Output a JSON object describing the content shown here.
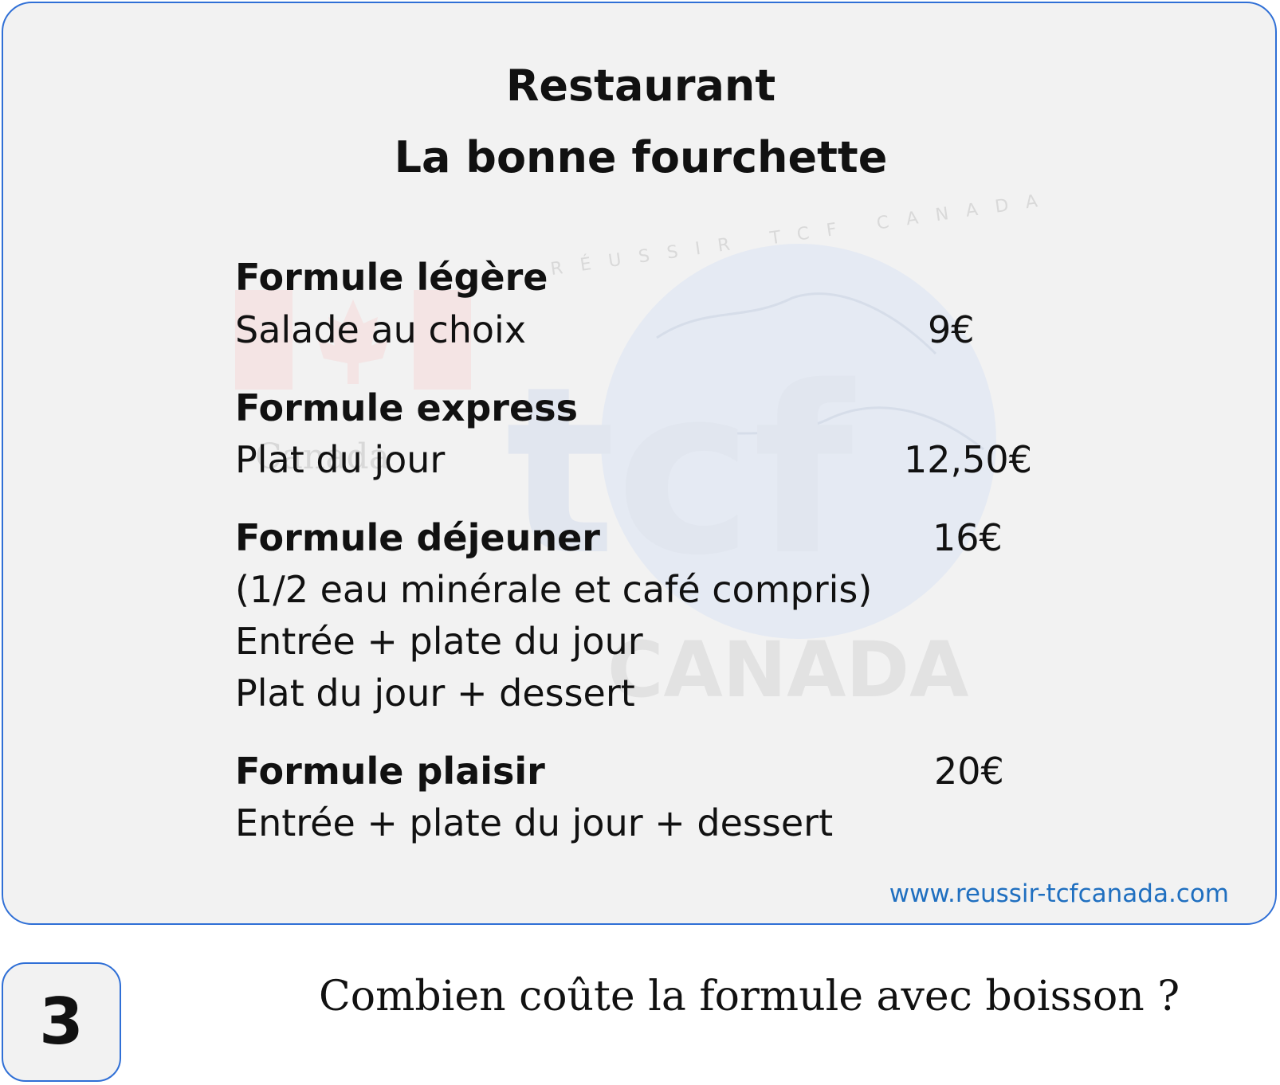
{
  "card": {
    "title_line1": "Restaurant",
    "title_line2": "La bonne fourchette",
    "website": "www.reussir-tcfcanada.com",
    "watermark": {
      "logo": "tcf",
      "word": "CANADA",
      "small_word": "Canada",
      "ring_text": "RÉUSSIR TCF CANADA",
      "emblems": [
        "canada-flag-icon",
        "globe-icon"
      ]
    }
  },
  "menu": [
    {
      "name": "Formule légère",
      "price": "",
      "lines": [
        "Salade au choix"
      ],
      "line_prices": [
        "9€"
      ]
    },
    {
      "name": "Formule express",
      "price": "",
      "lines": [
        "Plat du jour"
      ],
      "line_prices": [
        "12,50€"
      ]
    },
    {
      "name": "Formule déjeuner",
      "price": "16€",
      "lines": [
        "(1/2 eau minérale et café compris)",
        "Entrée + plate du jour",
        "Plat du jour + dessert"
      ],
      "line_prices": []
    },
    {
      "name": "Formule plaisir",
      "price": "20€",
      "lines": [
        "Entrée + plate du jour + dessert"
      ],
      "line_prices": []
    }
  ],
  "question": {
    "number": "3",
    "text": "Combien coûte la formule avec boisson ?"
  },
  "colors": {
    "border": "#2f6fd6",
    "card_background": "#f2f2f2",
    "website_link": "#1f6fc0",
    "text": "#111111"
  }
}
